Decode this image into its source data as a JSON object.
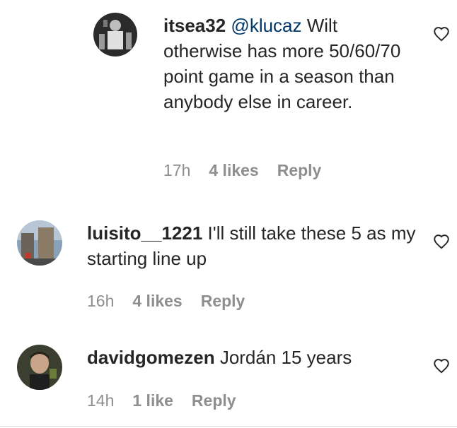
{
  "comments": [
    {
      "username": "itsea32",
      "mention": "@klucaz",
      "text": " Wilt otherwise has more 50/60/70 point game in a season than anybody else in career.",
      "time": "17h",
      "likes": "4 likes",
      "reply": "Reply",
      "avatar_icon": "avatar-image"
    },
    {
      "username": "luisito__1221",
      "text": " I'll still take these 5 as my starting line up",
      "time": "16h",
      "likes": "4 likes",
      "reply": "Reply",
      "avatar_icon": "avatar-image"
    },
    {
      "username": "davidgomezen",
      "text": " Jordán 15 years",
      "time": "14h",
      "likes": "1 like",
      "reply": "Reply",
      "avatar_icon": "avatar-image"
    }
  ],
  "icons": {
    "like": "heart-outline-icon"
  },
  "colors": {
    "text": "#262626",
    "meta": "#8e8e8e",
    "mention": "#00376b",
    "divider": "#dbdbdb"
  }
}
